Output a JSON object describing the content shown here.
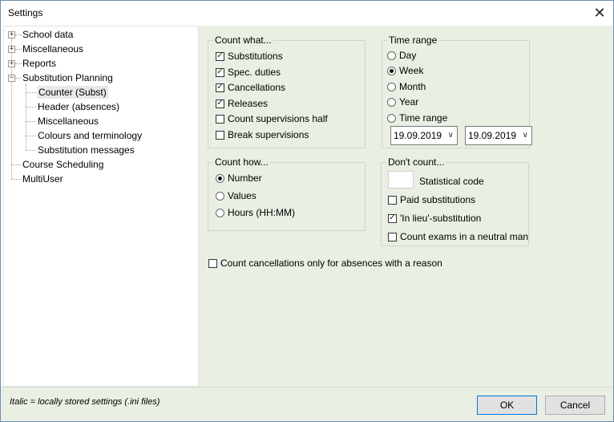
{
  "window": {
    "title": "Settings"
  },
  "tree": {
    "items": [
      {
        "label": "School data"
      },
      {
        "label": "Miscellaneous"
      },
      {
        "label": "Reports"
      },
      {
        "label": "Substitution Planning"
      },
      {
        "label": "Counter (Subst)"
      },
      {
        "label": "Header (absences)"
      },
      {
        "label": "Miscellaneous"
      },
      {
        "label": "Colours and terminology"
      },
      {
        "label": "Substitution messages"
      },
      {
        "label": "Course Scheduling"
      },
      {
        "label": "MultiUser"
      }
    ]
  },
  "count_what": {
    "title": "Count what...",
    "options": [
      {
        "label": "Substitutions",
        "checked": true
      },
      {
        "label": "Spec. duties",
        "checked": true
      },
      {
        "label": "Cancellations",
        "checked": true
      },
      {
        "label": "Releases",
        "checked": true
      },
      {
        "label": "Count supervisions half",
        "checked": false
      },
      {
        "label": "Break supervisions",
        "checked": false
      }
    ]
  },
  "time_range": {
    "title": "Time range",
    "options": [
      {
        "label": "Day",
        "selected": false
      },
      {
        "label": "Week",
        "selected": true
      },
      {
        "label": "Month",
        "selected": false
      },
      {
        "label": "Year",
        "selected": false
      },
      {
        "label": "Time range",
        "selected": false
      }
    ],
    "from_date": "19.09.2019",
    "to_date": "19.09.2019"
  },
  "count_how": {
    "title": "Count how...",
    "options": [
      {
        "label": "Number",
        "selected": true
      },
      {
        "label": "Values",
        "selected": false
      },
      {
        "label": "Hours (HH:MM)",
        "selected": false
      }
    ]
  },
  "dont_count": {
    "title": "Don't count...",
    "statistical_code_label": "Statistical code",
    "options": [
      {
        "label": "Paid substitutions",
        "checked": false
      },
      {
        "label": "'In lieu'-substitution",
        "checked": true
      },
      {
        "label": "Count exams in a neutral man",
        "checked": false
      }
    ]
  },
  "count_cancellations_reason": {
    "label": "Count cancellations only for absences with a reason",
    "checked": false
  },
  "footer": {
    "note": "Italic = locally stored settings (.ini files)",
    "ok_label": "OK",
    "cancel_label": "Cancel"
  },
  "icons": {
    "close": "close-icon",
    "expand": "expand-icon",
    "collapse": "collapse-icon",
    "chevron": "chevron-down-icon"
  }
}
